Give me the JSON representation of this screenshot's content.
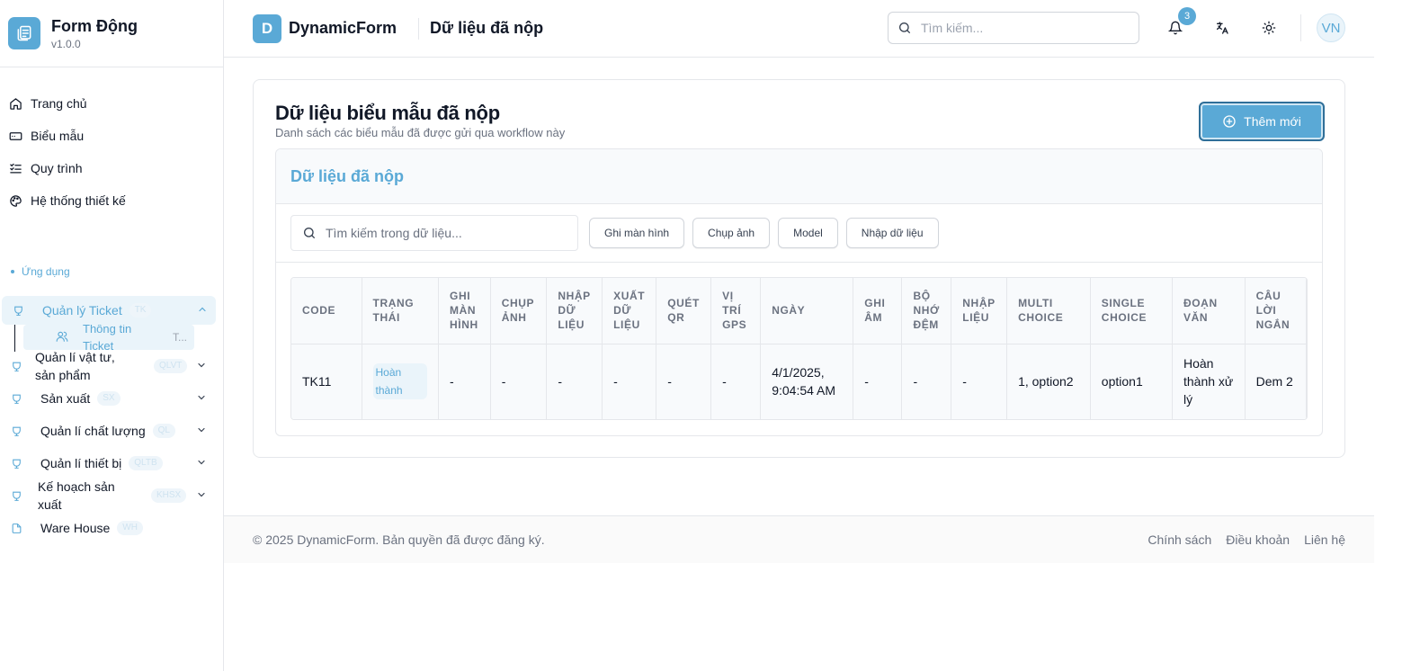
{
  "sidebar": {
    "title": "Form Động",
    "version": "v1.0.0",
    "nav": [
      {
        "label": "Trang chủ",
        "icon": "home-icon"
      },
      {
        "label": "Biểu mẫu",
        "icon": "form-icon"
      },
      {
        "label": "Quy trình",
        "icon": "list-check-icon"
      },
      {
        "label": "Hệ thống thiết kế",
        "icon": "palette-icon"
      }
    ],
    "section_label": "Ứng dụng",
    "apps": [
      {
        "label": "Quản lý Ticket",
        "pill": "TK"
      },
      {
        "label": "Quản lí vật tư, sản phẩm",
        "pill": "QLVT"
      },
      {
        "label": "Sản xuất",
        "pill": "SX"
      },
      {
        "label": "Quản lí chất lượng",
        "pill": "QL"
      },
      {
        "label": "Quản lí thiết bị",
        "pill": "QLTB"
      },
      {
        "label": "Kế hoạch sản xuất",
        "pill": "KHSX"
      },
      {
        "label": "Ware House",
        "pill": "WH"
      }
    ],
    "sub_item": {
      "label": "Thông tin Ticket",
      "trunc": "T..."
    }
  },
  "header": {
    "logo_letter": "D",
    "app_name": "DynamicForm",
    "page_title": "Dữ liệu đã nộp",
    "search_placeholder": "Tìm kiếm...",
    "notification_count": "3",
    "avatar": "VN"
  },
  "main": {
    "title": "Dữ liệu biểu mẫu đã nộp",
    "subtitle": "Danh sách các biểu mẫu đã được gửi qua workflow này",
    "add_button": "Thêm mới",
    "panel_title": "Dữ liệu đã nộp",
    "search_placeholder": "Tìm kiếm trong dữ liệu...",
    "toolbar_buttons": [
      "Ghi màn hình",
      "Chụp ảnh",
      "Model",
      "Nhập dữ liệu"
    ],
    "columns": [
      "CODE",
      "TRẠNG THÁI",
      "GHI MÀN HÌNH",
      "CHỤP ẢNH",
      "NHẬP DỮ LIỆU",
      "XUẤT DỮ LIỆU",
      "QUÉT QR",
      "VỊ TRÍ GPS",
      "NGÀY",
      "GHI ÂM",
      "BỘ NHỚ ĐỆM",
      "NHẬP LIỆU",
      "MULTI CHOICE",
      "SINGLE CHOICE",
      "ĐOẠN VĂN",
      "CÂU LỜI NGẮN"
    ],
    "rows": [
      [
        "TK11",
        "Hoàn thành",
        "-",
        "-",
        "-",
        "-",
        "-",
        "-",
        "4/1/2025, 9:04:54 AM",
        "-",
        "-",
        "-",
        "1, option2",
        "option1",
        "Hoàn thành xử lý",
        "Dem 2"
      ]
    ]
  },
  "footer": {
    "copyright": "© 2025 DynamicForm. Bản quyền đã được đăng ký.",
    "links": [
      "Chính sách",
      "Điều khoản",
      "Liên hệ"
    ]
  },
  "colors": {
    "accent": "#5aa9d6",
    "border": "#e5e7eb",
    "muted": "#6b7280"
  }
}
